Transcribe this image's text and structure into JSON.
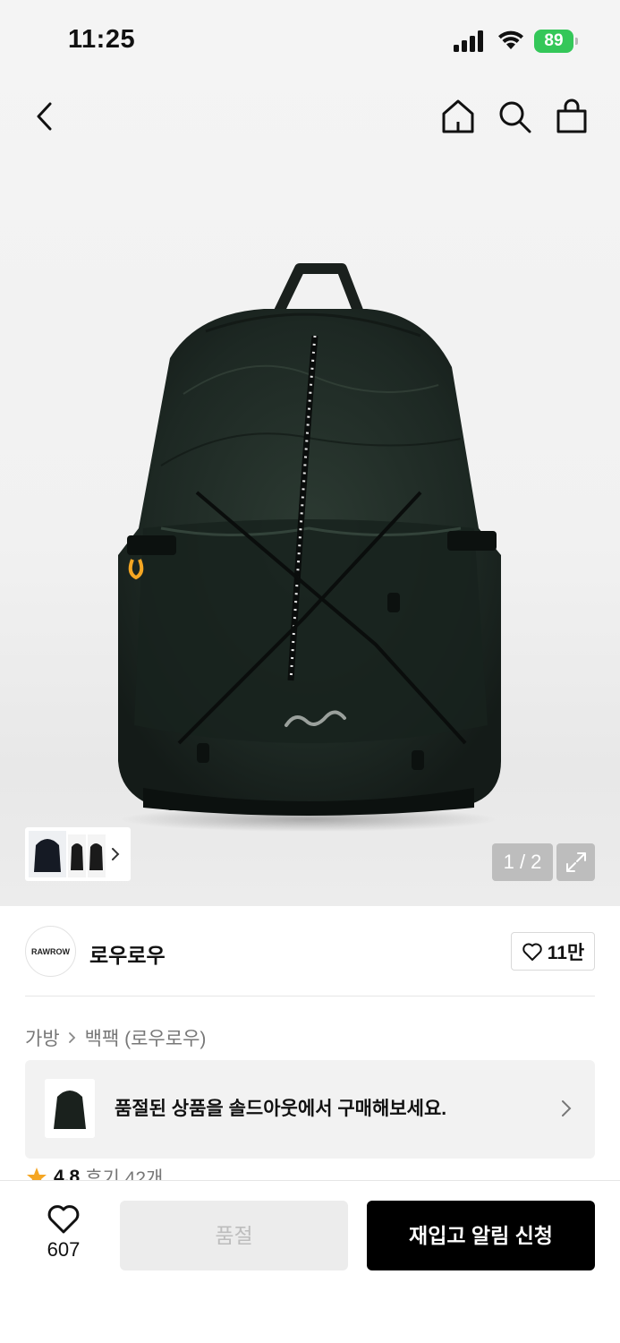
{
  "status_bar": {
    "time": "11:25",
    "battery": "89"
  },
  "nav": {
    "icons": [
      "back-chevron-icon",
      "home-icon",
      "search-icon",
      "shopping-bag-icon"
    ]
  },
  "gallery": {
    "counter": "1 / 2",
    "current_index": 1,
    "total": 2
  },
  "brand": {
    "logo_text": "RAWROW",
    "name": "로우로우",
    "likes": "11만"
  },
  "breadcrumb": {
    "category": "가방",
    "subcategory": "백팩 (로우로우)"
  },
  "soldout_banner": {
    "text": "품절된 상품을 솔드아웃에서 구매해보세요."
  },
  "rating": {
    "score": "4.8",
    "reviews": "후기 42개"
  },
  "bottom_bar": {
    "wish_count": "607",
    "soldout_label": "품절",
    "restock_label": "재입고 알림 신청"
  },
  "colors": {
    "battery": "#34c759",
    "primary_button": "#000000",
    "disabled_button": "#ececec",
    "star": "#f5a623"
  }
}
